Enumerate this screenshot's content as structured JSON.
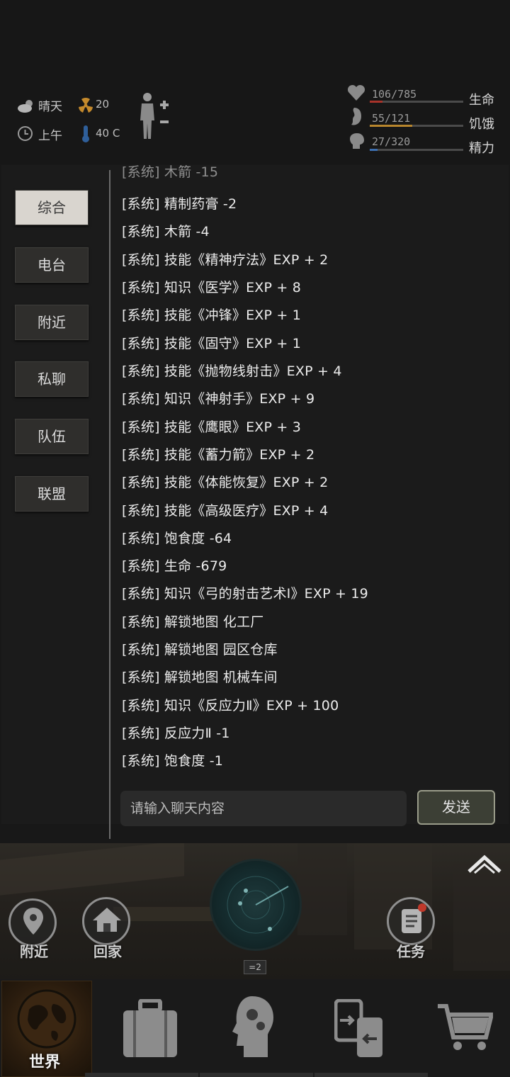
{
  "status": {
    "weather": "晴天",
    "radiation": "20",
    "time_of_day": "上午",
    "temperature": "40 C",
    "health": {
      "value": "106/785",
      "label": "生命",
      "fraction": 0.135,
      "color": "#a8332a"
    },
    "hunger": {
      "value": "55/121",
      "label": "饥饿",
      "fraction": 0.455,
      "color": "#b8862d"
    },
    "energy": {
      "value": "27/320",
      "label": "精力",
      "fraction": 0.084,
      "color": "#3d6fb0"
    },
    "icon_names": [
      "cloud-sun-icon",
      "radiation-icon",
      "clock-icon",
      "thermometer-icon",
      "body-icon",
      "heart-icon",
      "stomach-icon",
      "head-icon"
    ]
  },
  "channels": [
    "综合",
    "电台",
    "附近",
    "私聊",
    "队伍",
    "联盟"
  ],
  "active_channel": 0,
  "messages": [
    "[系统] 木箭 -15",
    "[系统] 精制药膏 -2",
    "[系统] 木箭 -4",
    "[系统] 技能《精神疗法》EXP + 2",
    "[系统] 知识《医学》EXP + 8",
    "[系统] 技能《冲锋》EXP + 1",
    "[系统] 技能《固守》EXP + 1",
    "[系统] 技能《抛物线射击》EXP + 4",
    "[系统] 知识《神射手》EXP + 9",
    "[系统] 技能《鹰眼》EXP + 3",
    "[系统] 技能《蓄力箭》EXP + 2",
    "[系统] 技能《体能恢复》EXP + 2",
    "[系统] 技能《高级医疗》EXP + 4",
    "[系统] 饱食度 -64",
    "[系统] 生命 -679",
    "[系统] 知识《弓的射击艺术Ⅰ》EXP + 19",
    "[系统] 解锁地图 化工厂",
    "[系统] 解锁地图 园区仓库",
    "[系统] 解锁地图 机械车间",
    "[系统] 知识《反应力Ⅱ》EXP + 100",
    "[系统] 反应力Ⅱ -1",
    "[系统] 饱食度 -1"
  ],
  "input": {
    "placeholder": "请输入聊天内容",
    "value": ""
  },
  "send_label": "发送",
  "actions": {
    "nearby": "附近",
    "home": "回家",
    "task": "任务",
    "radar_count": "=2"
  },
  "nav": {
    "world": "世界"
  },
  "icons": [
    "chevron-up-icon",
    "map-pin-icon",
    "house-icon",
    "scroll-icon",
    "radar-icon",
    "globe-icon",
    "suitcase-icon",
    "brain-head-icon",
    "swap-cards-icon",
    "cart-icon"
  ]
}
